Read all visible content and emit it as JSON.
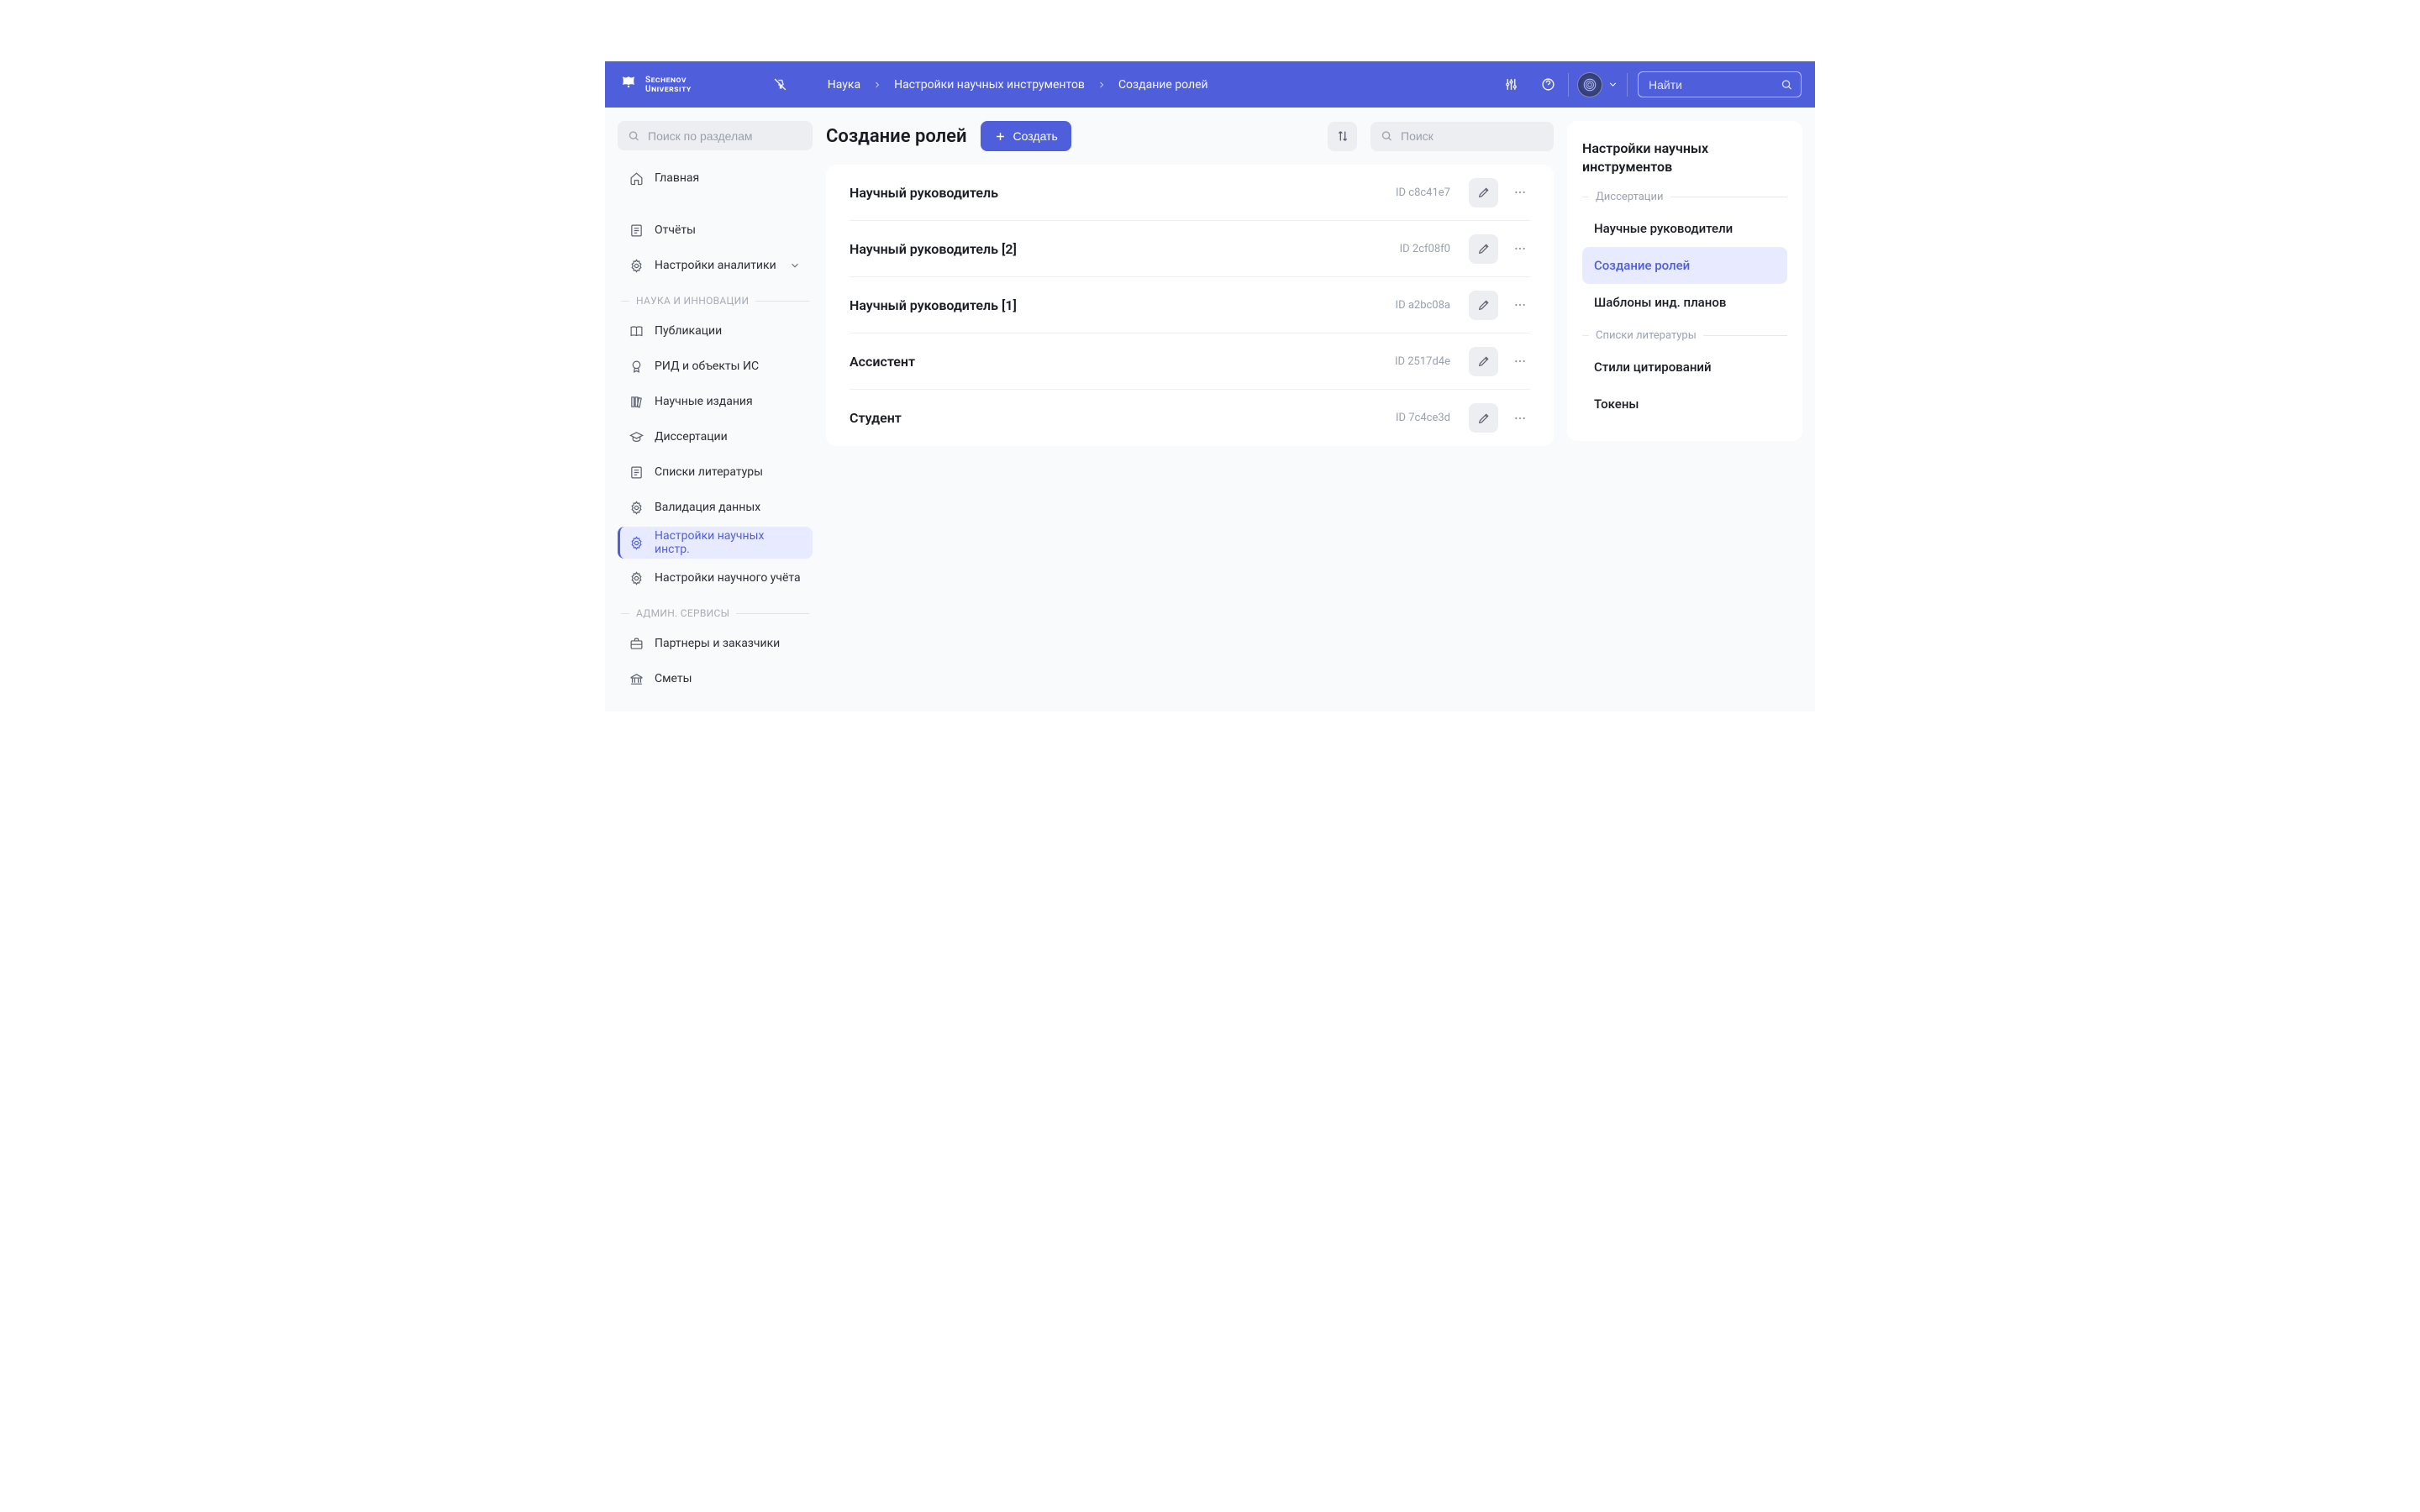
{
  "logo": {
    "line1": "Sechenov",
    "line2": "University"
  },
  "breadcrumb": [
    {
      "label": "Наука"
    },
    {
      "label": "Настройки научных инструментов"
    },
    {
      "label": "Создание ролей"
    }
  ],
  "header_search": {
    "placeholder": "Найти"
  },
  "sidebar_search": {
    "placeholder": "Поиск по разделам"
  },
  "sidebar": {
    "top": [
      {
        "name": "home",
        "label": "Главная"
      }
    ],
    "clipped_label": "Отчёты",
    "analytics": {
      "label": "Настройки аналитики"
    },
    "section_science": "НАУКА И ИННОВАЦИИ",
    "science_items": [
      {
        "name": "pubs",
        "label": "Публикации"
      },
      {
        "name": "rid",
        "label": "РИД и объекты ИС"
      },
      {
        "name": "editions",
        "label": "Научные издания"
      },
      {
        "name": "diss",
        "label": "Диссертации"
      },
      {
        "name": "litlists",
        "label": "Списки литературы"
      },
      {
        "name": "validation",
        "label": "Валидация данных"
      },
      {
        "name": "sci-tools",
        "label": "Настройки научных инстр.",
        "active": true
      },
      {
        "name": "sci-acct",
        "label": "Настройки научного учёта"
      }
    ],
    "section_admin": "АДМИН. СЕРВИСЫ",
    "admin_items": [
      {
        "name": "partners",
        "label": "Партнеры и заказчики"
      },
      {
        "name": "budgets",
        "label": "Сметы"
      }
    ]
  },
  "page_title": "Создание ролей",
  "create_button": "Создать",
  "main_search": {
    "placeholder": "Поиск"
  },
  "roles": [
    {
      "title": "Научный руководитель",
      "id": "ID c8c41e7"
    },
    {
      "title": "Научный руководитель [2]",
      "id": "ID 2cf08f0"
    },
    {
      "title": "Научный руководитель [1]",
      "id": "ID a2bc08a"
    },
    {
      "title": "Ассистент",
      "id": "ID 2517d4e"
    },
    {
      "title": "Студент",
      "id": "ID 7c4ce3d"
    }
  ],
  "right_panel": {
    "title": "Настройки научных инструментов",
    "section_diss": "Диссертации",
    "items_diss": [
      {
        "label": "Научные руководители"
      },
      {
        "label": "Создание ролей",
        "active": true
      },
      {
        "label": "Шаблоны инд. планов"
      }
    ],
    "section_lit": "Списки литературы",
    "items_lit": [
      {
        "label": "Стили цитирований"
      },
      {
        "label": "Токены"
      }
    ]
  }
}
